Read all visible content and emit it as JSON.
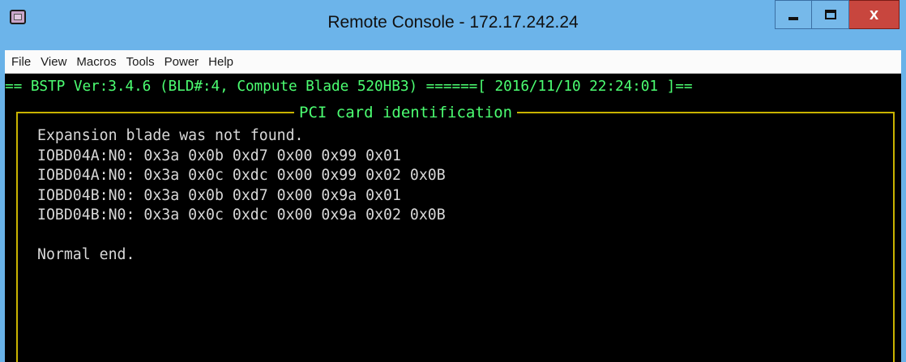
{
  "window": {
    "title": "Remote Console - 172.17.242.24",
    "controls": {
      "minimize": "–",
      "maximize": "□",
      "close": "x"
    }
  },
  "menu": [
    "File",
    "View",
    "Macros",
    "Tools",
    "Power",
    "Help"
  ],
  "console": {
    "status_line": "== BSTP Ver:3.4.6 (BLD#:4, Compute Blade 520HB3) ======[ 2016/11/10 22:24:01 ]==",
    "panel_title": "PCI card identification",
    "lines": [
      "Expansion blade was not found.",
      "IOBD04A:N0: 0x3a 0x0b 0xd7 0x00 0x99 0x01",
      "IOBD04A:N0: 0x3a 0x0c 0xdc 0x00 0x99 0x02 0x0B",
      "IOBD04B:N0: 0x3a 0x0b 0xd7 0x00 0x9a 0x01",
      "IOBD04B:N0: 0x3a 0x0c 0xdc 0x00 0x9a 0x02 0x0B",
      "",
      "Normal end."
    ]
  },
  "colors": {
    "titlebar": "#6cb4ea",
    "console_bg": "#000000",
    "status_text": "#4cff72",
    "frame_border": "#c9b300",
    "console_text": "#d8d8d8",
    "close_button": "#c8463e"
  },
  "icons": {
    "app": "remote-console-app-icon"
  }
}
